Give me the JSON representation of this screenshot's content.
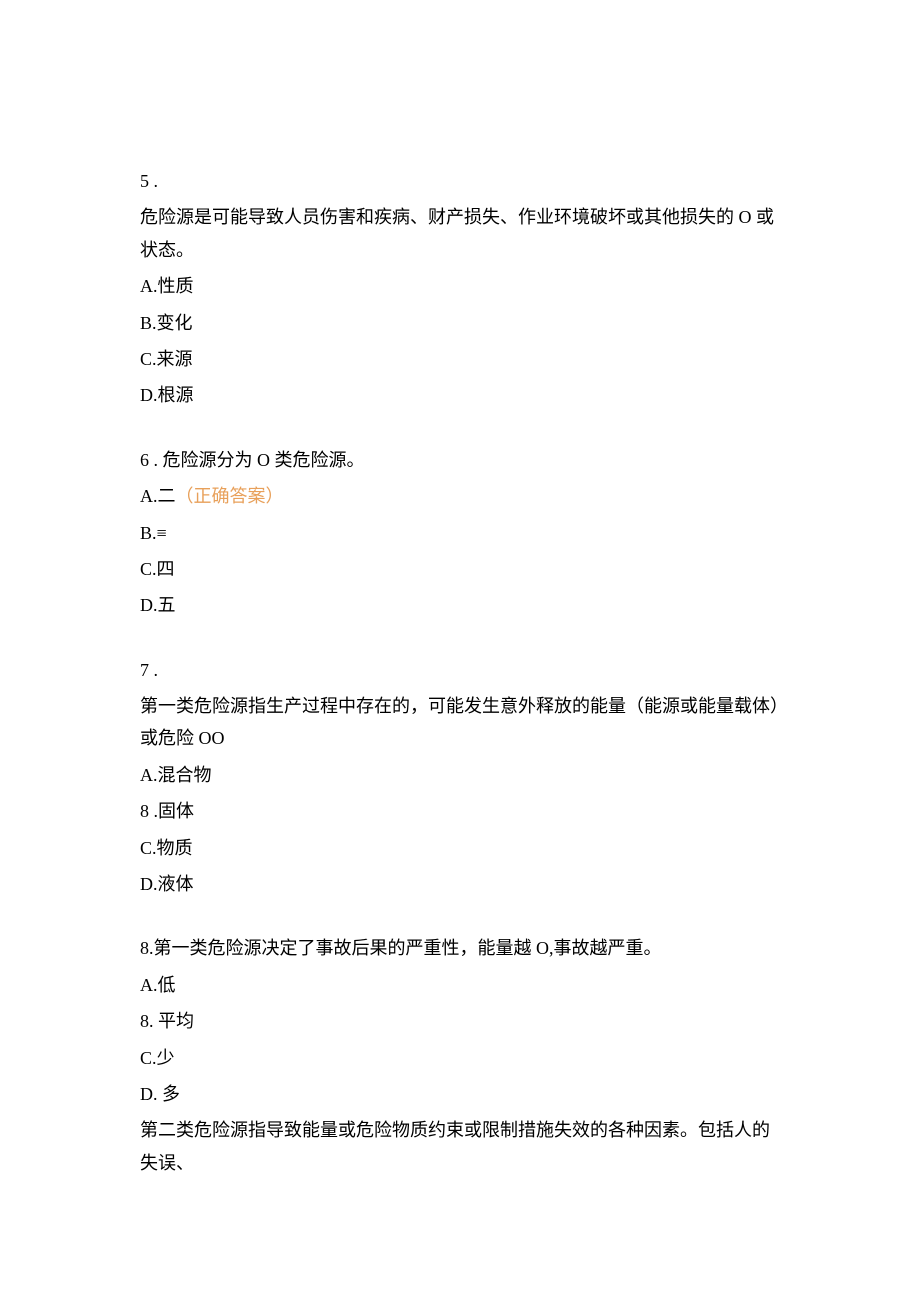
{
  "questions": [
    {
      "number": "5   .",
      "stem": "危险源是可能导致人员伤害和疾病、财产损失、作业环境破坏或其他损失的 O 或状态。",
      "options": [
        {
          "label": "A.性质",
          "correct": ""
        },
        {
          "label": "B.变化",
          "correct": ""
        },
        {
          "label": "C.来源",
          "correct": ""
        },
        {
          "label": "D.根源",
          "correct": ""
        }
      ]
    },
    {
      "number": "6   . 危险源分为 O 类危险源。",
      "stem": "",
      "options": [
        {
          "label": "A.二",
          "correct": "（正确答案）"
        },
        {
          "label": "B.≡",
          "correct": ""
        },
        {
          "label": "C.四",
          "correct": ""
        },
        {
          "label": "D.五",
          "correct": ""
        }
      ]
    },
    {
      "number": "7   .",
      "stem": "第一类危险源指生产过程中存在的，可能发生意外释放的能量（能源或能量载体）或危险 OO",
      "options": [
        {
          "label": "A.混合物",
          "correct": ""
        },
        {
          "label": "8   .固体",
          "correct": ""
        },
        {
          "label": "C.物质",
          "correct": ""
        },
        {
          "label": "D.液体",
          "correct": ""
        }
      ]
    },
    {
      "number": "8.第一类危险源决定了事故后果的严重性，能量越 O,事故越严重。",
      "stem": "",
      "options": [
        {
          "label": "A.低",
          "correct": ""
        },
        {
          "label": "8.   平均",
          "correct": ""
        },
        {
          "label": "C.少",
          "correct": ""
        },
        {
          "label": "D. 多",
          "correct": ""
        }
      ]
    }
  ],
  "trailing_text": "第二类危险源指导致能量或危险物质约束或限制措施失效的各种因素。包括人的失误、"
}
